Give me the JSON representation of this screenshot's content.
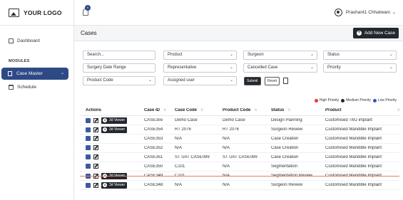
{
  "sidebar": {
    "logo": "YOUR LOGO",
    "dashboard": "Dashboard",
    "modules": "MODULES",
    "case_master": "Case Master",
    "schedule": "Schedule"
  },
  "header": {
    "notif_count": "9",
    "user_name": "Prashant1 Chhatwani"
  },
  "page": {
    "title": "Cases",
    "add_button": "Add New Case"
  },
  "filters": {
    "search_placeholder": "Search...",
    "product": "Product",
    "surgeon": "Surgeon",
    "status": "Status",
    "surgery_date_range": "Surgery Date Range",
    "representative": "Representative",
    "cancelled_case": "Cancelled Case",
    "priority": "Priority",
    "product_code": "Product Code",
    "assigned_user": "Assigned user",
    "submit": "Submit",
    "reset": "Reset"
  },
  "legend": {
    "high": "High Priority",
    "medium": "Medium Priority",
    "low": "Low Priority",
    "colors": {
      "high": "#e53935",
      "medium": "#23272e",
      "low": "#3f51b5"
    }
  },
  "table": {
    "columns": [
      "Actions",
      "Case ID",
      "Case Code",
      "Product Code",
      "Status",
      "Product"
    ],
    "viewer_label": "3d Viewer",
    "rows": [
      {
        "id": "CASE355",
        "code": "Demo Case",
        "pcode": "Demo Case",
        "status": "Design Planning",
        "product": "Customised TMJ implant",
        "viewer": true,
        "strike": false
      },
      {
        "id": "CASE354",
        "code": "RT 2076",
        "pcode": "RT 2076",
        "status": "Surgeon Review",
        "product": "Customised Mandible Implant",
        "viewer": true,
        "strike": false
      },
      {
        "id": "CASE353",
        "code": "N/A",
        "pcode": "N/A",
        "status": "Case Creation",
        "product": "Customised Mandible Implant",
        "viewer": false,
        "strike": false
      },
      {
        "id": "CASE352",
        "code": "N/A",
        "pcode": "N/A",
        "status": "Case Creation",
        "product": "Customised Mandible Implant",
        "viewer": false,
        "strike": false
      },
      {
        "id": "CASE351",
        "code": "ST UAT CASE089",
        "pcode": "ST UAT CASE089",
        "status": "Case Creation",
        "product": "Customised Mandible Implant",
        "viewer": false,
        "strike": false
      },
      {
        "id": "CASE350",
        "code": "C101",
        "pcode": "N/A",
        "status": "Segmentation",
        "product": "Customised Mandible Implant",
        "viewer": false,
        "strike": false
      },
      {
        "id": "CASE349",
        "code": "C101",
        "pcode": "N/A",
        "status": "Segmentation Review",
        "product": "Customised Mandible Implant",
        "viewer": true,
        "strike": true
      },
      {
        "id": "CASE348",
        "code": "N/A",
        "pcode": "N/A",
        "status": "Surgeon Review",
        "product": "Customised Mandible Implant",
        "viewer": true,
        "strike": false
      }
    ]
  }
}
